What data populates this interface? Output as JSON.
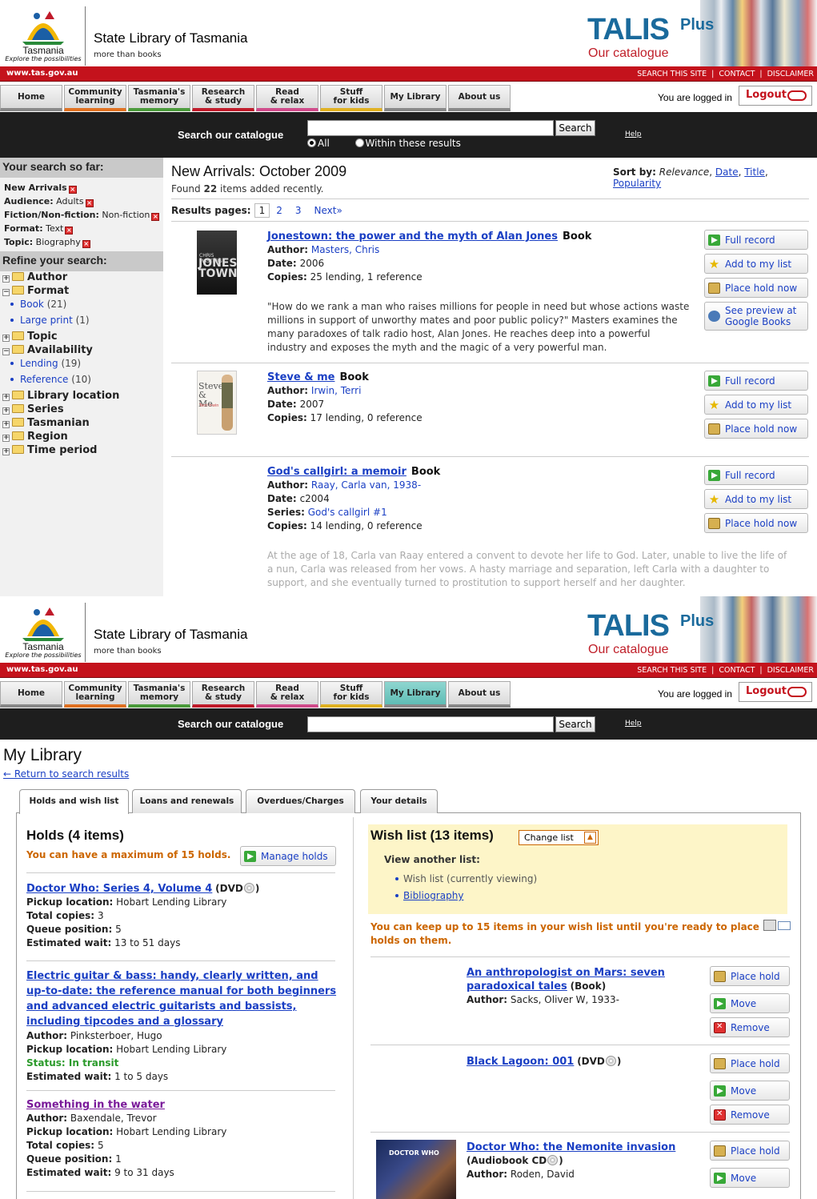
{
  "header": {
    "logo_text": "Tasmania",
    "logo_tagline": "Explore the possibilities",
    "site_name": "State Library of Tasmania",
    "site_tagline": "more than books",
    "talis": "TALIS",
    "plus": "Plus",
    "our_catalogue": "Our catalogue",
    "url": "www.tas.gov.au",
    "util_links": [
      "SEARCH THIS SITE",
      "CONTACT",
      "DISCLAIMER"
    ]
  },
  "nav": {
    "items": [
      {
        "line1": "Home",
        "line2": ""
      },
      {
        "line1": "Community",
        "line2": "learning"
      },
      {
        "line1": "Tasmania's",
        "line2": "memory"
      },
      {
        "line1": "Research",
        "line2": "& study"
      },
      {
        "line1": "Read",
        "line2": "& relax"
      },
      {
        "line1": "Stuff",
        "line2": "for kids"
      },
      {
        "line1": "My Library",
        "line2": ""
      },
      {
        "line1": "About us",
        "line2": ""
      }
    ],
    "accent_colors": [
      "#999999",
      "#e07020",
      "#4a9a3a",
      "#c01a2a",
      "#d04a8a",
      "#e0b020",
      "#999999",
      "#999999"
    ],
    "logged_in": "You are logged in",
    "logout": "Logout"
  },
  "search": {
    "label": "Search our catalogue",
    "button": "Search",
    "help": "Help",
    "radio_all": "All",
    "radio_within": "Within these results"
  },
  "sidebar": {
    "so_far_title": "Your search so far:",
    "so_far": [
      {
        "key": "New Arrivals",
        "value": ""
      },
      {
        "key": "Audience:",
        "value": "Adults"
      },
      {
        "key": "Fiction/Non-fiction:",
        "value": "Non-fiction"
      },
      {
        "key": "Format:",
        "value": "Text"
      },
      {
        "key": "Topic:",
        "value": "Biography"
      }
    ],
    "refine_title": "Refine your search:",
    "tree": {
      "author": "Author",
      "format": "Format",
      "book": "Book",
      "book_count": "(21)",
      "large_print": "Large print",
      "large_print_count": "(1)",
      "topic": "Topic",
      "availability": "Availability",
      "lending": "Lending",
      "lending_count": "(19)",
      "reference": "Reference",
      "reference_count": "(10)",
      "library_location": "Library location",
      "series": "Series",
      "tasmanian": "Tasmanian",
      "region": "Region",
      "time_period": "Time period"
    }
  },
  "results": {
    "title": "New Arrivals: October 2009",
    "found_pre": "Found",
    "found_count": "22",
    "found_post": "items added recently.",
    "sort_label": "Sort by:",
    "sort_current": "Relevance",
    "sort_options": [
      "Date",
      "Title",
      "Popularity"
    ],
    "pages_label": "Results pages:",
    "pages": [
      "1",
      "2",
      "3"
    ],
    "next": "Next»",
    "labels": {
      "author": "Author:",
      "date": "Date:",
      "copies": "Copies:",
      "series": "Series:"
    },
    "items": [
      {
        "title": "Jonestown: the power and the myth of Alan Jones",
        "type": "Book",
        "author": "Masters, Chris",
        "date": "2006",
        "copies": "25 lending, 1 reference",
        "description": "\"How do we rank a man who raises millions for people in need but whose actions waste millions in support of unworthy mates and poor public policy?\" Masters examines the many paradoxes of talk radio host, Alan Jones. He reaches deep into a powerful industry and exposes the myth and the magic of a very powerful man.",
        "cover_text": "JONES TOWN",
        "cover_author": "CHRIS MASTERS"
      },
      {
        "title": "Steve & me",
        "type": "Book",
        "author": "Irwin, Terri",
        "date": "2007",
        "copies": "17 lending, 0 reference",
        "cover_text": "Steve & Me",
        "cover_author": "Terri Irwin"
      },
      {
        "title": "God's callgirl: a memoir",
        "type": "Book",
        "author": "Raay, Carla van, 1938-",
        "date": "c2004",
        "series": "God's callgirl #1",
        "copies": "14 lending, 0 reference",
        "description": "At the age of 18, Carla van Raay entered a convent to devote her life to God. Later, unable to live the life of a nun, Carla was released from her vows. A hasty marriage and separation, left Carla with a daughter to support, and she eventually turned to prostitution to support herself and her daughter."
      }
    ],
    "actions": {
      "full_record": "Full record",
      "add_to_list": "Add to my list",
      "place_hold": "Place hold now",
      "preview": "See preview at Google Books"
    }
  },
  "mylibrary": {
    "title": "My Library",
    "back": "← Return to search results",
    "tabs": [
      "Holds and wish list",
      "Loans and renewals",
      "Overdues/Charges",
      "Your details"
    ],
    "holds": {
      "title": "Holds (4 items)",
      "max_note": "You can have a maximum of 15 holds.",
      "manage": "Manage holds",
      "labels": {
        "pickup": "Pickup location:",
        "copies": "Total copies:",
        "queue": "Queue position:",
        "wait": "Estimated wait:",
        "author": "Author:",
        "status": "Status:"
      },
      "items": [
        {
          "title": "Doctor Who: Series 4, Volume 4",
          "type": "(DVD",
          "type_end": ")",
          "pickup": "Hobart Lending Library",
          "copies": "3",
          "queue": "5",
          "wait": "13 to 51 days"
        },
        {
          "title": "Electric guitar & bass: handy, clearly written, and up-to-date: the reference manual for both beginners and advanced electric guitarists and bassists, including tipcodes and a glossary",
          "author": "Pinksterboer, Hugo",
          "pickup": "Hobart Lending Library",
          "status": "In transit",
          "wait": "1 to 5 days"
        },
        {
          "title": "Something in the water",
          "author": "Baxendale, Trevor",
          "pickup": "Hobart Lending Library",
          "copies": "5",
          "queue": "1",
          "wait": "9 to 31 days"
        }
      ]
    },
    "wishlist": {
      "title": "Wish list (13 items)",
      "change": "Change list",
      "view_another": "View another list:",
      "current": "Wish list (currently viewing)",
      "other": "Bibliography",
      "note": "You can keep up to 15 items in your wish list until you're ready to place holds on them.",
      "author_label": "Author:",
      "items": [
        {
          "title": "An anthropologist on Mars: seven paradoxical tales",
          "type": "(Book)",
          "author": "Sacks, Oliver W, 1933-"
        },
        {
          "title": "Black Lagoon: 001",
          "type": "(DVD",
          "type_end": ")"
        },
        {
          "title": "Doctor Who: the Nemonite invasion",
          "type": "(Audiobook CD",
          "type_end": ")",
          "author": "Roden, David",
          "cover_text": "DOCTOR WHO"
        }
      ],
      "actions": {
        "place_hold": "Place hold",
        "move": "Move",
        "remove": "Remove"
      }
    }
  }
}
